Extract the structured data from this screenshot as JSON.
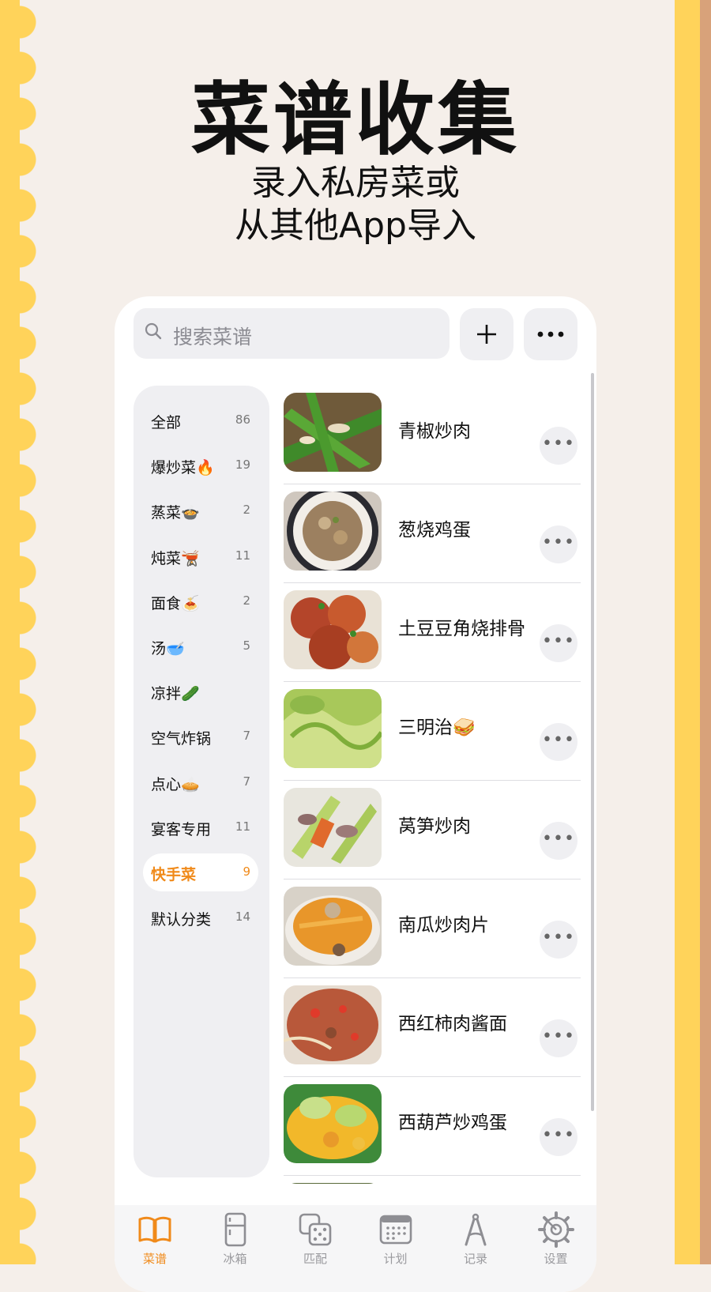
{
  "header": {
    "title": "菜谱收集",
    "subtitle_line1": "录入私房菜或",
    "subtitle_line2": "从其他App导入"
  },
  "search": {
    "placeholder": "搜索菜谱"
  },
  "categories": [
    {
      "label": "全部",
      "count": "86"
    },
    {
      "label": "爆炒菜🔥",
      "count": "19"
    },
    {
      "label": "蒸菜🍲",
      "count": "2"
    },
    {
      "label": "炖菜🫕",
      "count": "11"
    },
    {
      "label": "面食🍝",
      "count": "2"
    },
    {
      "label": "汤🥣",
      "count": "5"
    },
    {
      "label": "凉拌🥒",
      "count": ""
    },
    {
      "label": "空气炸锅",
      "count": "7"
    },
    {
      "label": "点心🥧",
      "count": "7"
    },
    {
      "label": "宴客专用",
      "count": "11"
    },
    {
      "label": "快手菜",
      "count": "9",
      "selected": true
    },
    {
      "label": "默认分类",
      "count": "14"
    }
  ],
  "recipes": [
    {
      "name": "青椒炒肉",
      "more": "•••"
    },
    {
      "name": "葱烧鸡蛋",
      "more": "•••"
    },
    {
      "name": "土豆豆角烧排骨",
      "more": "•••"
    },
    {
      "name": "三明治🥪",
      "more": "•••"
    },
    {
      "name": "莴笋炒肉",
      "more": "•••"
    },
    {
      "name": "南瓜炒肉片",
      "more": "•••"
    },
    {
      "name": "西红柿肉酱面",
      "more": "•••"
    },
    {
      "name": "西葫芦炒鸡蛋",
      "more": "•••"
    }
  ],
  "tabs": [
    {
      "label": "菜谱",
      "icon": "book-icon",
      "active": true
    },
    {
      "label": "冰箱",
      "icon": "fridge-icon"
    },
    {
      "label": "匹配",
      "icon": "dice-icon"
    },
    {
      "label": "计划",
      "icon": "calendar-icon"
    },
    {
      "label": "记录",
      "icon": "compass-icon"
    },
    {
      "label": "设置",
      "icon": "gear-icon"
    }
  ],
  "colors": {
    "accent": "#f08a1a",
    "border_yellow": "#ffd35a",
    "background": "#f5efea"
  }
}
